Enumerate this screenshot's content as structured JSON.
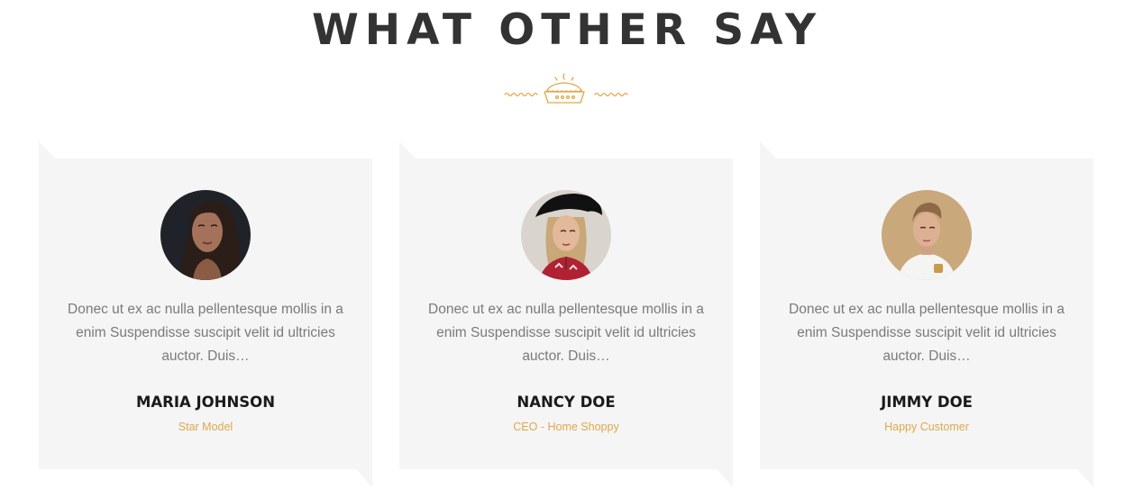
{
  "section": {
    "title": "WHAT OTHER SAY"
  },
  "colors": {
    "accent": "#e0a84a",
    "card_background": "#f5f5f5",
    "title": "#333333",
    "body_text": "#7a7a7a"
  },
  "divider": {
    "icon": "pie-icon"
  },
  "testimonials": [
    {
      "avatar_icon": "avatar-photo",
      "quote": "Donec ut ex ac nulla pellentesque mollis in a enim Suspendisse suscipit velit id ultricies auctor. Duis…",
      "name": "MARIA JOHNSON",
      "role": "Star Model"
    },
    {
      "avatar_icon": "avatar-photo",
      "quote": "Donec ut ex ac nulla pellentesque mollis in a enim Suspendisse suscipit velit id ultricies auctor. Duis…",
      "name": "NANCY DOE",
      "role": "CEO - Home Shoppy"
    },
    {
      "avatar_icon": "avatar-photo",
      "quote": "Donec ut ex ac nulla pellentesque mollis in a enim Suspendisse suscipit velit id ultricies auctor. Duis…",
      "name": "JIMMY DOE",
      "role": "Happy Customer"
    }
  ]
}
